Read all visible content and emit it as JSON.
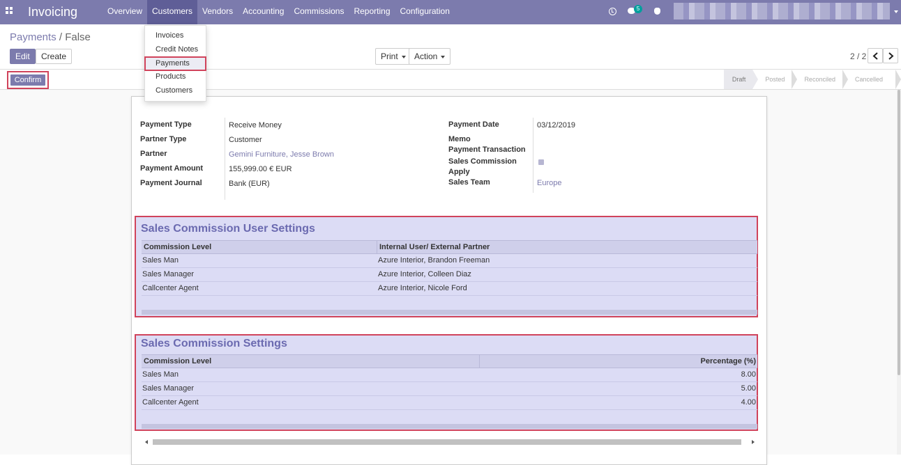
{
  "app": {
    "title": "Invoicing"
  },
  "nav": {
    "items": [
      "Overview",
      "Customers",
      "Vendors",
      "Accounting",
      "Commissions",
      "Reporting",
      "Configuration"
    ],
    "active": "Customers"
  },
  "notifications": {
    "chat_count": "5"
  },
  "dropdown": {
    "items": [
      "Invoices",
      "Credit Notes",
      "Payments",
      "Products",
      "Customers"
    ],
    "highlighted": "Payments"
  },
  "breadcrumb": {
    "parent": "Payments",
    "separator": "/",
    "current": "False"
  },
  "toolbar": {
    "edit_label": "Edit",
    "create_label": "Create",
    "print_label": "Print",
    "action_label": "Action"
  },
  "pager": {
    "text": "2 / 2"
  },
  "statusbar": {
    "confirm_label": "Confirm",
    "stages": [
      "Draft",
      "Posted",
      "Reconciled",
      "Cancelled"
    ],
    "current_stage": "Draft"
  },
  "form": {
    "left": [
      {
        "label": "Payment Type",
        "value": "Receive Money"
      },
      {
        "label": "Partner Type",
        "value": "Customer"
      },
      {
        "label": "Partner",
        "value": "Gemini Furniture, Jesse Brown"
      },
      {
        "label": "Payment Amount",
        "value": "155,999.00 € EUR"
      },
      {
        "label": "Payment Journal",
        "value": "Bank (EUR)"
      }
    ],
    "right": [
      {
        "label": "Payment Date",
        "value": "03/12/2019"
      },
      {
        "label": "Memo",
        "value": ""
      },
      {
        "label": "Payment Transaction",
        "value": ""
      },
      {
        "label": "Sales Commission Apply",
        "value": "checked"
      },
      {
        "label": "Sales Team",
        "value": "Europe"
      }
    ]
  },
  "user_settings": {
    "title": "Sales Commission User Settings",
    "columns": [
      "Commission Level",
      "Internal User/ External Partner"
    ],
    "rows": [
      [
        "Sales Man",
        "Azure Interior, Brandon Freeman"
      ],
      [
        "Sales Manager",
        "Azure Interior, Colleen Diaz"
      ],
      [
        "Callcenter Agent",
        "Azure Interior, Nicole Ford"
      ]
    ]
  },
  "settings": {
    "title": "Sales Commission Settings",
    "columns": [
      "Commission Level",
      "Percentage (%)"
    ],
    "rows": [
      [
        "Sales Man",
        "8.00"
      ],
      [
        "Sales Manager",
        "5.00"
      ],
      [
        "Callcenter Agent",
        "4.00"
      ]
    ]
  },
  "colors": {
    "brand": "#7c7bad",
    "highlight_border": "#d0435b",
    "section_bg": "#dcdcf5",
    "badge": "#00a09d"
  }
}
